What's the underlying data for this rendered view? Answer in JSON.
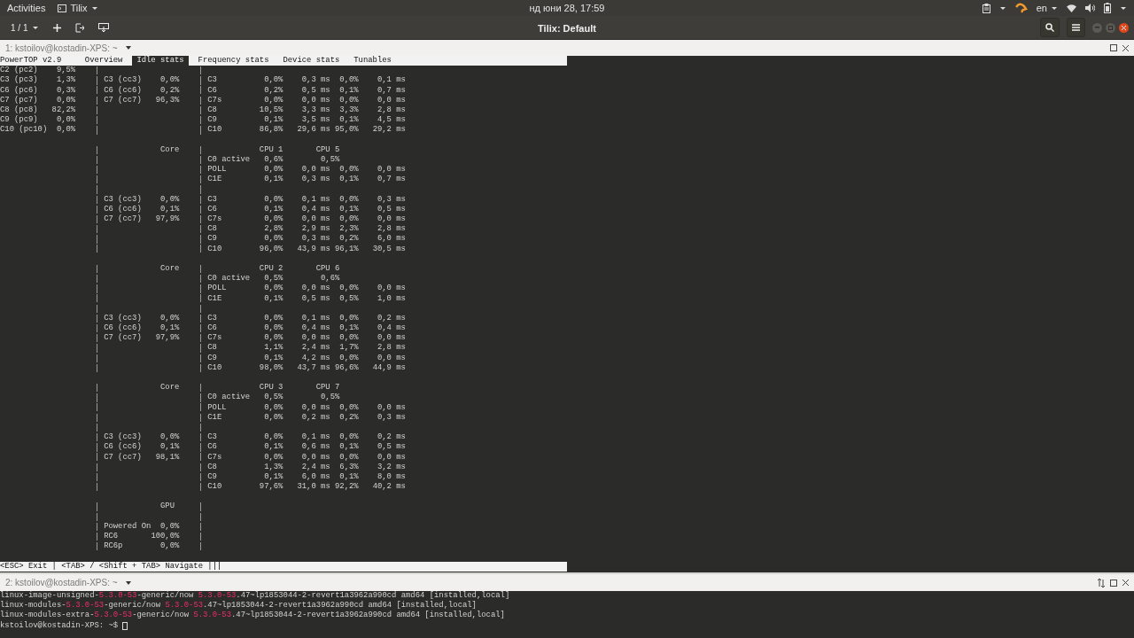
{
  "top_bar": {
    "activities": "Activities",
    "app_menu": "Tilix",
    "clock": "нд юни 28, 17:59",
    "keyboard_layout": "en"
  },
  "header_bar": {
    "session_switcher": "1 / 1",
    "title": "Tilix: Default"
  },
  "pane_1": {
    "title": "1: kstoilov@kostadin-XPS: ~",
    "app_title": "PowerTOP v2.9",
    "tabs": [
      {
        "label": "Overview",
        "selected": false
      },
      {
        "label": "Idle stats",
        "selected": true
      },
      {
        "label": "Frequency stats",
        "selected": false
      },
      {
        "label": "Device stats",
        "selected": false
      },
      {
        "label": "Tunables",
        "selected": false
      }
    ],
    "rows": [
      {
        "kind": "stats",
        "package": [
          "C2 (pc2)",
          "9,5%"
        ]
      },
      {
        "kind": "stats",
        "package": [
          "C3 (pc3)",
          "1,3%"
        ],
        "core": [
          "C3 (cc3)",
          "0,0%"
        ],
        "cpu": [
          "C3",
          "0,0%",
          "0,3 ms",
          "0,0%",
          "0,1 ms"
        ]
      },
      {
        "kind": "stats",
        "package": [
          "C6 (pc6)",
          "0,3%"
        ],
        "core": [
          "C6 (cc6)",
          "0,2%"
        ],
        "cpu": [
          "C6",
          "0,2%",
          "0,5 ms",
          "0,1%",
          "0,7 ms"
        ]
      },
      {
        "kind": "stats",
        "package": [
          "C7 (pc7)",
          "0,0%"
        ],
        "core": [
          "C7 (cc7)",
          "96,3%"
        ],
        "cpu": [
          "C7s",
          "0,0%",
          "0,0 ms",
          "0,0%",
          "0,0 ms"
        ]
      },
      {
        "kind": "stats",
        "package": [
          "C8 (pc8)",
          "82,2%"
        ],
        "cpu": [
          "C8",
          "10,5%",
          "3,3 ms",
          "3,3%",
          "2,8 ms"
        ]
      },
      {
        "kind": "stats",
        "package": [
          "C9 (pc9)",
          "0,0%"
        ],
        "cpu": [
          "C9",
          "0,1%",
          "3,5 ms",
          "0,1%",
          "4,5 ms"
        ]
      },
      {
        "kind": "stats",
        "package": [
          "C10 (pc10)",
          "0,0%"
        ],
        "cpu": [
          "C10",
          "86,8%",
          "29,6 ms",
          "95,0%",
          "29,2 ms"
        ]
      },
      {
        "kind": "gap"
      },
      {
        "kind": "heading",
        "core_heading": "Core",
        "cpu_headings": [
          "CPU 1",
          "CPU 5"
        ]
      },
      {
        "kind": "active",
        "cpu": [
          "C0 active",
          "0,6%",
          "0,5%"
        ]
      },
      {
        "kind": "stats",
        "cpu": [
          "POLL",
          "0,0%",
          "0,0 ms",
          "0,0%",
          "0,0 ms"
        ]
      },
      {
        "kind": "stats",
        "cpu": [
          "C1E",
          "0,1%",
          "0,3 ms",
          "0,1%",
          "0,7 ms"
        ]
      },
      {
        "kind": "stats"
      },
      {
        "kind": "stats",
        "core": [
          "C3 (cc3)",
          "0,0%"
        ],
        "cpu": [
          "C3",
          "0,0%",
          "0,1 ms",
          "0,0%",
          "0,3 ms"
        ]
      },
      {
        "kind": "stats",
        "core": [
          "C6 (cc6)",
          "0,1%"
        ],
        "cpu": [
          "C6",
          "0,1%",
          "0,4 ms",
          "0,1%",
          "0,5 ms"
        ]
      },
      {
        "kind": "stats",
        "core": [
          "C7 (cc7)",
          "97,9%"
        ],
        "cpu": [
          "C7s",
          "0,0%",
          "0,0 ms",
          "0,0%",
          "0,0 ms"
        ]
      },
      {
        "kind": "stats",
        "cpu": [
          "C8",
          "2,8%",
          "2,9 ms",
          "2,3%",
          "2,8 ms"
        ]
      },
      {
        "kind": "stats",
        "cpu": [
          "C9",
          "0,0%",
          "0,3 ms",
          "0,2%",
          "6,0 ms"
        ]
      },
      {
        "kind": "stats",
        "cpu": [
          "C10",
          "96,0%",
          "43,9 ms",
          "96,1%",
          "30,5 ms"
        ]
      },
      {
        "kind": "gap"
      },
      {
        "kind": "heading",
        "core_heading": "Core",
        "cpu_headings": [
          "CPU 2",
          "CPU 6"
        ]
      },
      {
        "kind": "active",
        "cpu": [
          "C0 active",
          "0,5%",
          "0,6%"
        ]
      },
      {
        "kind": "stats",
        "cpu": [
          "POLL",
          "0,0%",
          "0,0 ms",
          "0,0%",
          "0,0 ms"
        ]
      },
      {
        "kind": "stats",
        "cpu": [
          "C1E",
          "0,1%",
          "0,5 ms",
          "0,5%",
          "1,0 ms"
        ]
      },
      {
        "kind": "stats"
      },
      {
        "kind": "stats",
        "core": [
          "C3 (cc3)",
          "0,0%"
        ],
        "cpu": [
          "C3",
          "0,0%",
          "0,1 ms",
          "0,0%",
          "0,2 ms"
        ]
      },
      {
        "kind": "stats",
        "core": [
          "C6 (cc6)",
          "0,1%"
        ],
        "cpu": [
          "C6",
          "0,0%",
          "0,4 ms",
          "0,1%",
          "0,4 ms"
        ]
      },
      {
        "kind": "stats",
        "core": [
          "C7 (cc7)",
          "97,9%"
        ],
        "cpu": [
          "C7s",
          "0,0%",
          "0,0 ms",
          "0,0%",
          "0,0 ms"
        ]
      },
      {
        "kind": "stats",
        "cpu": [
          "C8",
          "1,1%",
          "2,4 ms",
          "1,7%",
          "2,8 ms"
        ]
      },
      {
        "kind": "stats",
        "cpu": [
          "C9",
          "0,1%",
          "4,2 ms",
          "0,0%",
          "0,0 ms"
        ]
      },
      {
        "kind": "stats",
        "cpu": [
          "C10",
          "98,0%",
          "43,7 ms",
          "96,6%",
          "44,9 ms"
        ]
      },
      {
        "kind": "gap"
      },
      {
        "kind": "heading",
        "core_heading": "Core",
        "cpu_headings": [
          "CPU 3",
          "CPU 7"
        ]
      },
      {
        "kind": "active",
        "cpu": [
          "C0 active",
          "0,5%",
          "0,5%"
        ]
      },
      {
        "kind": "stats",
        "cpu": [
          "POLL",
          "0,0%",
          "0,0 ms",
          "0,0%",
          "0,0 ms"
        ]
      },
      {
        "kind": "stats",
        "cpu": [
          "C1E",
          "0,0%",
          "0,2 ms",
          "0,2%",
          "0,3 ms"
        ]
      },
      {
        "kind": "stats"
      },
      {
        "kind": "stats",
        "core": [
          "C3 (cc3)",
          "0,0%"
        ],
        "cpu": [
          "C3",
          "0,0%",
          "0,1 ms",
          "0,0%",
          "0,2 ms"
        ]
      },
      {
        "kind": "stats",
        "core": [
          "C6 (cc6)",
          "0,1%"
        ],
        "cpu": [
          "C6",
          "0,1%",
          "0,6 ms",
          "0,1%",
          "0,5 ms"
        ]
      },
      {
        "kind": "stats",
        "core": [
          "C7 (cc7)",
          "98,1%"
        ],
        "cpu": [
          "C7s",
          "0,0%",
          "0,0 ms",
          "0,0%",
          "0,0 ms"
        ]
      },
      {
        "kind": "stats",
        "cpu": [
          "C8",
          "1,3%",
          "2,4 ms",
          "6,3%",
          "3,2 ms"
        ]
      },
      {
        "kind": "stats",
        "cpu": [
          "C9",
          "0,1%",
          "6,0 ms",
          "0,1%",
          "8,0 ms"
        ]
      },
      {
        "kind": "stats",
        "cpu": [
          "C10",
          "97,6%",
          "31,0 ms",
          "92,2%",
          "40,2 ms"
        ]
      },
      {
        "kind": "gap"
      },
      {
        "kind": "heading",
        "core_heading": "GPU"
      },
      {
        "kind": "stats"
      },
      {
        "kind": "stats",
        "core": [
          "Powered On",
          "0,0%"
        ]
      },
      {
        "kind": "stats",
        "core": [
          "RC6",
          "100,0%"
        ]
      },
      {
        "kind": "stats",
        "core": [
          "RC6p",
          "0,0%"
        ]
      },
      {
        "kind": "gap"
      }
    ],
    "status_bar": "<ESC> Exit | <TAB> / <Shift + TAB> Navigate |"
  },
  "pane_2": {
    "title": "2: kstoilov@kostadin-XPS: ~",
    "lines": [
      [
        {
          "text": "linux-image-unsigned-"
        },
        {
          "text": "5.3.0-53",
          "highlight": true
        },
        {
          "text": "-generic/now "
        },
        {
          "text": "5.3.0-53",
          "highlight": true
        },
        {
          "text": ".47~lp1853044-2-revert1a3962a990cd amd64 [installed,local]"
        }
      ],
      [
        {
          "text": "linux-modules-"
        },
        {
          "text": "5.3.0-53",
          "highlight": true
        },
        {
          "text": "-generic/now "
        },
        {
          "text": "5.3.0-53",
          "highlight": true
        },
        {
          "text": ".47~lp1853044-2-revert1a3962a990cd amd64 [installed,local]"
        }
      ],
      [
        {
          "text": "linux-modules-extra-"
        },
        {
          "text": "5.3.0-53",
          "highlight": true
        },
        {
          "text": "-generic/now "
        },
        {
          "text": "5.3.0-53",
          "highlight": true
        },
        {
          "text": ".47~lp1853044-2-revert1a3962a990cd amd64 [installed,local]"
        }
      ]
    ],
    "prompt": "kstoilov@kostadin-XPS: ~$"
  }
}
